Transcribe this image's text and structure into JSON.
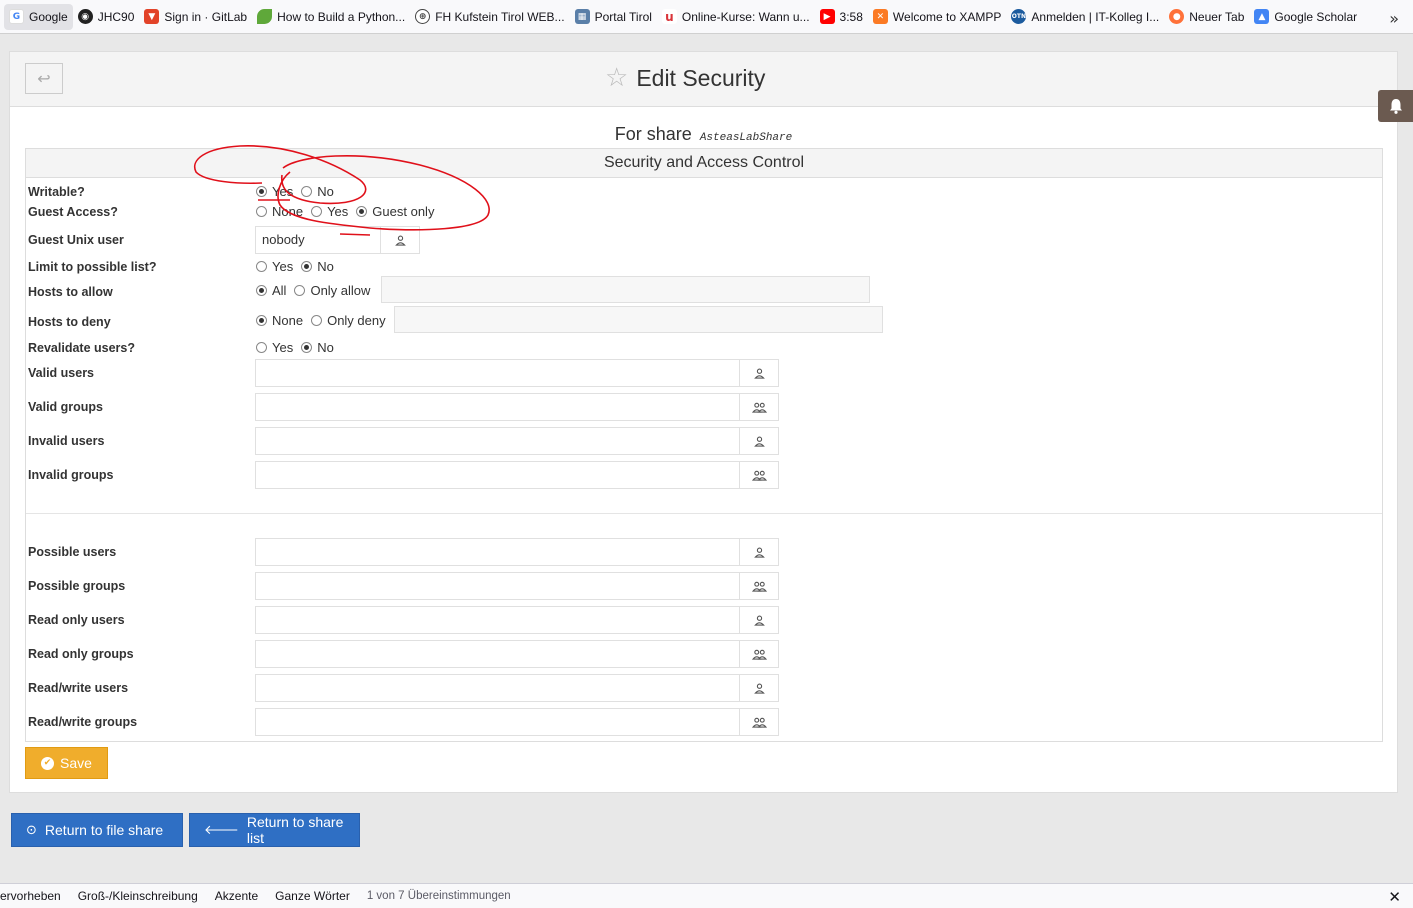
{
  "bookmarks": [
    {
      "label": "Google",
      "icon": "google-icon",
      "color": "#4285f4"
    },
    {
      "label": "JHC90",
      "icon": "github-icon",
      "color": "#222222"
    },
    {
      "label": "Sign in · GitLab",
      "icon": "gitlab-icon",
      "color": "#e24329"
    },
    {
      "label": "How to Build a Python...",
      "icon": "leaf-icon",
      "color": "#5fa83a"
    },
    {
      "label": "FH Kufstein Tirol WEB...",
      "icon": "globe-icon",
      "color": "#444444"
    },
    {
      "label": "Portal Tirol",
      "icon": "portal-icon",
      "color": "#5a7fa8"
    },
    {
      "label": "Online-Kurse: Wann u...",
      "icon": "udemy-icon",
      "color": "#d9343a"
    },
    {
      "label": "3:58",
      "icon": "youtube-icon",
      "color": "#ff0000"
    },
    {
      "label": "Welcome to XAMPP",
      "icon": "xampp-icon",
      "color": "#fb7a24"
    },
    {
      "label": "Anmelden | IT-Kolleg I...",
      "icon": "otn-icon",
      "color": "#1c5b9e"
    },
    {
      "label": "Neuer Tab",
      "icon": "firefox-icon",
      "color": "#ff7139"
    },
    {
      "label": "Google Scholar",
      "icon": "scholar-icon",
      "color": "#4285f4"
    }
  ],
  "header": {
    "title": "Edit Security",
    "back_icon": "back-arrow-icon",
    "star_icon": "star-icon"
  },
  "share": {
    "prefix": "For share",
    "name": "AsteasLabShare"
  },
  "section_title": "Security and Access Control",
  "options": {
    "writable": {
      "label": "Writable?",
      "choices": [
        "Yes",
        "No"
      ],
      "selected": "Yes"
    },
    "guest_access": {
      "label": "Guest Access?",
      "choices": [
        "None",
        "Yes",
        "Guest only"
      ],
      "selected": "Guest only"
    },
    "guest_unix_user": {
      "label": "Guest Unix user",
      "value": "nobody"
    },
    "limit_possible": {
      "label": "Limit to possible list?",
      "choices": [
        "Yes",
        "No"
      ],
      "selected": "No"
    },
    "hosts_allow": {
      "label": "Hosts to allow",
      "choices": [
        "All",
        "Only allow"
      ],
      "selected": "All"
    },
    "hosts_deny": {
      "label": "Hosts to deny",
      "choices": [
        "None",
        "Only deny"
      ],
      "selected": "None"
    },
    "revalidate": {
      "label": "Revalidate users?",
      "choices": [
        "Yes",
        "No"
      ],
      "selected": "No"
    }
  },
  "user_fields": [
    {
      "label": "Valid users",
      "kind": "user",
      "value": ""
    },
    {
      "label": "Valid groups",
      "kind": "group",
      "value": ""
    },
    {
      "label": "Invalid users",
      "kind": "user",
      "value": ""
    },
    {
      "label": "Invalid groups",
      "kind": "group",
      "value": ""
    },
    {
      "label": "Possible users",
      "kind": "user",
      "value": ""
    },
    {
      "label": "Possible groups",
      "kind": "group",
      "value": ""
    },
    {
      "label": "Read only users",
      "kind": "user",
      "value": ""
    },
    {
      "label": "Read only groups",
      "kind": "group",
      "value": ""
    },
    {
      "label": "Read/write users",
      "kind": "user",
      "value": ""
    },
    {
      "label": "Read/write groups",
      "kind": "group",
      "value": ""
    }
  ],
  "buttons": {
    "save": "Save",
    "return_file_share": "Return to file share",
    "return_share_list": "Return to share list"
  },
  "findbar": {
    "highlight": "ervorheben",
    "match_case": "Groß-/Kleinschreibung",
    "diacritics": "Akzente",
    "whole_words": "Ganze Wörter",
    "status": "1 von 7 Übereinstimmungen"
  },
  "colors": {
    "save": "#f0ad2c",
    "nav_button": "#2f6fc4",
    "annotation": "#e0101a"
  }
}
